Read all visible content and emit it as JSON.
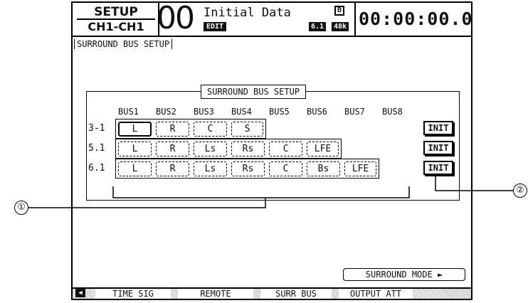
{
  "header": {
    "screen_name": "SETUP",
    "channel": "CH1-CH1",
    "scene_number": "00",
    "scene_title": "Initial Data",
    "edit_badge": "EDIT",
    "b_badge": "B",
    "surround_mode_badge": "6.1",
    "sample_rate_badge": "48k",
    "timecode": "00:00:00.00"
  },
  "page_title": "SURROUND BUS SETUP",
  "panel": {
    "title": "SURROUND BUS SETUP",
    "bus_headers": [
      "BUS1",
      "BUS2",
      "BUS3",
      "BUS4",
      "BUS5",
      "BUS6",
      "BUS7",
      "BUS8"
    ],
    "rows": [
      {
        "label": "3-1",
        "cells": [
          "L",
          "R",
          "C",
          "S"
        ],
        "init": "INIT"
      },
      {
        "label": "5.1",
        "cells": [
          "L",
          "R",
          "Ls",
          "Rs",
          "C",
          "LFE"
        ],
        "init": "INIT"
      },
      {
        "label": "6.1",
        "cells": [
          "L",
          "R",
          "Ls",
          "Rs",
          "C",
          "Bs",
          "LFE"
        ],
        "init": "INIT"
      }
    ]
  },
  "surround_mode_button": "SURROUND MODE",
  "tabs": [
    "TIME SIG",
    "REMOTE",
    "SURR BUS",
    "OUTPUT ATT"
  ],
  "active_tab": "SURR BUS",
  "callouts": [
    "①",
    "②"
  ]
}
